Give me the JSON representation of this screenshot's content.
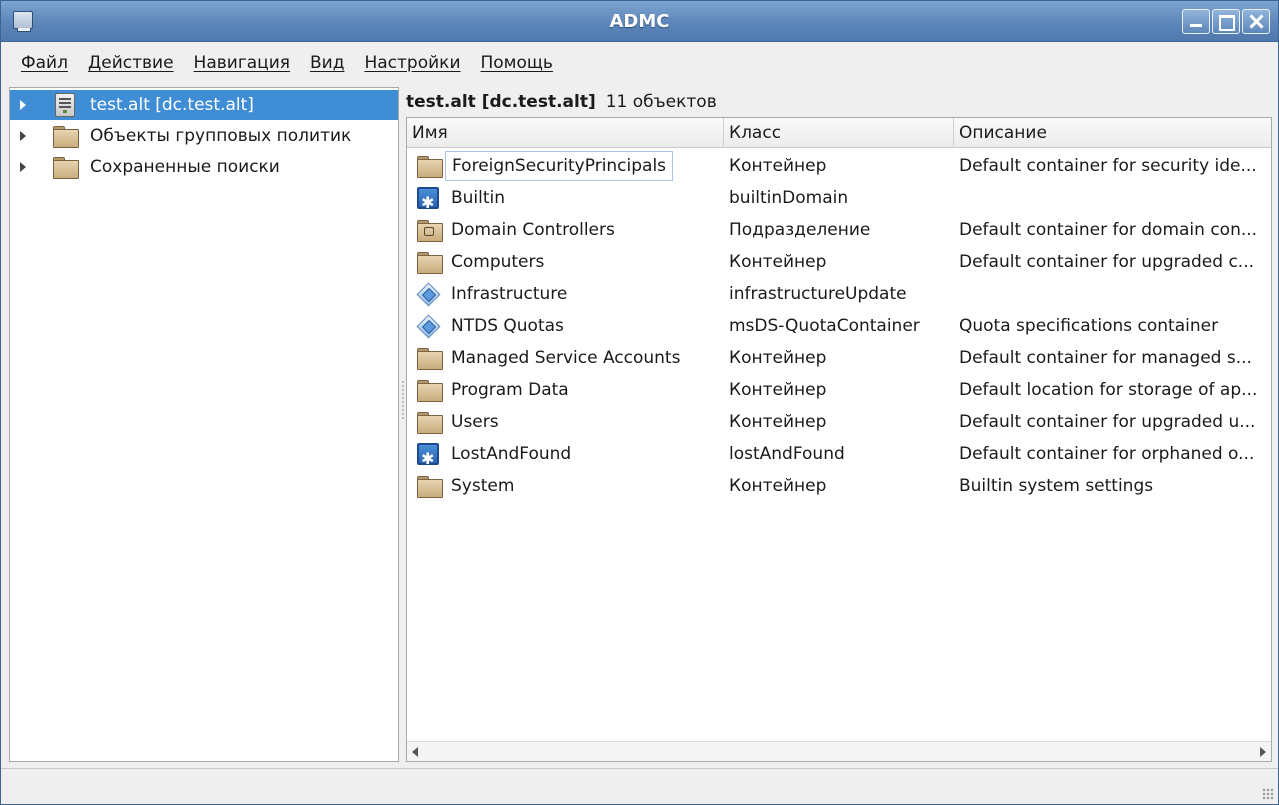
{
  "window": {
    "title": "ADMC"
  },
  "menubar": {
    "items": [
      "Файл",
      "Действие",
      "Навигация",
      "Вид",
      "Настройки",
      "Помощь"
    ]
  },
  "tree": {
    "items": [
      {
        "label": "test.alt [dc.test.alt]",
        "icon": "server-icon",
        "selected": true
      },
      {
        "label": "Объекты групповых политик",
        "icon": "folder-icon",
        "selected": false
      },
      {
        "label": "Сохраненные поиски",
        "icon": "folder-icon",
        "selected": false
      }
    ]
  },
  "content": {
    "location": "test.alt [dc.test.alt]",
    "count": "11 объектов",
    "columns": [
      "Имя",
      "Класс",
      "Описание"
    ],
    "rows": [
      {
        "name": "ForeignSecurityPrincipals",
        "class": "Контейнер",
        "description": "Default container for security ide...",
        "icon": "folder-icon"
      },
      {
        "name": "Builtin",
        "class": "builtinDomain",
        "description": "",
        "icon": "builtin-icon"
      },
      {
        "name": "Domain Controllers",
        "class": "Подразделение",
        "description": "Default container for domain con...",
        "icon": "ou-folder-icon"
      },
      {
        "name": "Computers",
        "class": "Контейнер",
        "description": "Default container for upgraded c...",
        "icon": "folder-icon"
      },
      {
        "name": "Infrastructure",
        "class": "infrastructureUpdate",
        "description": "",
        "icon": "diamond-icon"
      },
      {
        "name": "NTDS Quotas",
        "class": "msDS-QuotaContainer",
        "description": "Quota specifications container",
        "icon": "diamond-icon"
      },
      {
        "name": "Managed Service Accounts",
        "class": "Контейнер",
        "description": "Default container for managed s...",
        "icon": "folder-icon"
      },
      {
        "name": "Program Data",
        "class": "Контейнер",
        "description": "Default location for storage of ap...",
        "icon": "folder-icon"
      },
      {
        "name": "Users",
        "class": "Контейнер",
        "description": "Default container for upgraded u...",
        "icon": "folder-icon"
      },
      {
        "name": "LostAndFound",
        "class": "lostAndFound",
        "description": "Default container for orphaned o...",
        "icon": "builtin-icon"
      },
      {
        "name": "System",
        "class": "Контейнер",
        "description": "Builtin system settings",
        "icon": "folder-icon"
      }
    ]
  }
}
